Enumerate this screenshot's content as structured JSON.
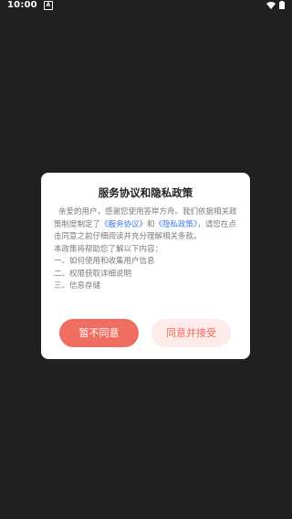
{
  "status_bar": {
    "time": "10:00",
    "notification_icon_letter": "A"
  },
  "dialog": {
    "title": "服务协议和隐私政策",
    "intro_part1": "亲爱的用户，感谢您使用答岸方舟。我们依据相关政策制度制定了",
    "link_service": "《服务协议》",
    "and_text": "和",
    "link_privacy": "《隐私政策》",
    "intro_part2": "，请您在点击同意之前仔细阅读并充分理解相关条款。",
    "help_line": "本政策将帮助您了解以下内容：",
    "items": [
      "一、如何使用和收集用户信息",
      "二、权限获取详细说明",
      "三、信息存储"
    ],
    "decline_label": "暂不同意",
    "accept_label": "同意并接受"
  },
  "colors": {
    "accent": "#ef6d61",
    "accent_light": "#fdecea",
    "link": "#3b78e7",
    "background": "#202020"
  }
}
